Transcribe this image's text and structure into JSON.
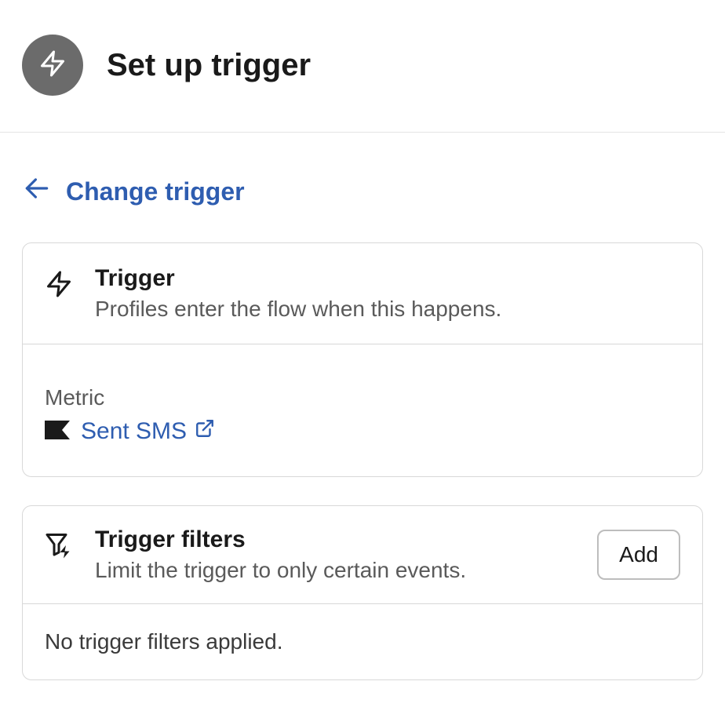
{
  "header": {
    "title": "Set up trigger"
  },
  "changeTrigger": {
    "label": "Change trigger"
  },
  "triggerCard": {
    "title": "Trigger",
    "subtitle": "Profiles enter the flow when this happens.",
    "metricLabel": "Metric",
    "metricValue": "Sent SMS"
  },
  "filtersCard": {
    "title": "Trigger filters",
    "subtitle": "Limit the trigger to only certain events.",
    "addLabel": "Add",
    "emptyText": "No trigger filters applied."
  }
}
